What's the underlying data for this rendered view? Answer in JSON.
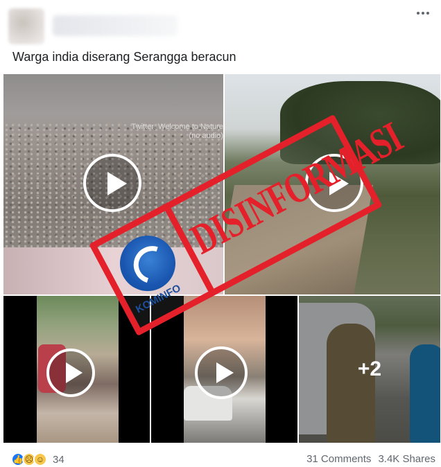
{
  "post": {
    "caption": "Warga india diserang Serangga beracun"
  },
  "media": {
    "video1_watermark": "Twitter: Welcome to Nature (no audio)",
    "more_count": "+2"
  },
  "stamp": {
    "label": "DISINFORMASI",
    "logo_text": "KOMINFO"
  },
  "footer": {
    "reaction_count": "34",
    "comments": "31 Comments",
    "shares": "3.4K Shares"
  },
  "icons": [
    "like-icon",
    "sad-icon",
    "haha-icon",
    "play-icon",
    "more-options-icon",
    "kominfo-logo-icon"
  ],
  "colors": {
    "stamp_red": "#e4202a",
    "like_blue": "#1877f2",
    "meta_gray": "#606770"
  }
}
